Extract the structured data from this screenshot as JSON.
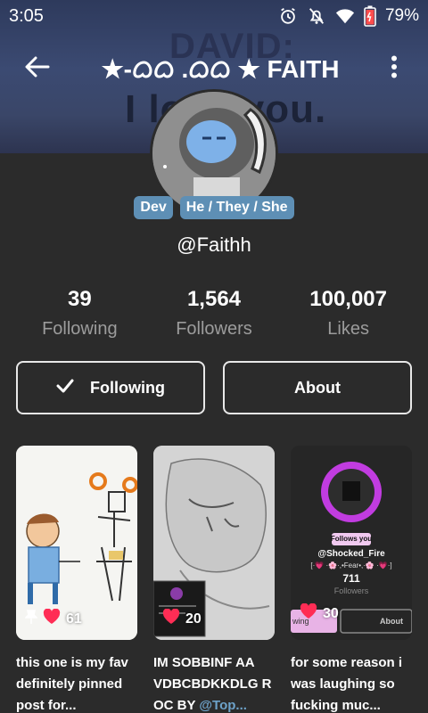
{
  "status_bar": {
    "time": "3:05",
    "battery": "79%",
    "icons": [
      "alarm-icon",
      "notifications-off-icon",
      "wifi-icon",
      "battery-icon"
    ]
  },
  "banner": {
    "line1": "DAVID:",
    "line2": "I love you."
  },
  "header": {
    "title": "★-ᜊᜊ .ᜊᜊ ★ FAITH",
    "icons": [
      "back-arrow-icon",
      "more-vertical-icon"
    ]
  },
  "profile": {
    "badges": [
      "Dev",
      "He / They / She"
    ],
    "username": "@Faithh"
  },
  "stats": [
    {
      "value": "39",
      "label": "Following"
    },
    {
      "value": "1,564",
      "label": "Followers"
    },
    {
      "value": "100,007",
      "label": "Likes"
    }
  ],
  "actions": {
    "following_label": "Following",
    "about_label": "About"
  },
  "posts": [
    {
      "likes": "61",
      "caption": "this one is my fav definitely pinned post for...",
      "pinned": true
    },
    {
      "likes": "20",
      "caption_text": "IM SOBBINF AA VDBCBDKKDLG R OC BY ",
      "caption_mention": "@Top..."
    },
    {
      "likes": "30",
      "caption": "for some reason i was laughing so fucking muc..."
    }
  ],
  "post3_embed": {
    "follows_you": "Follows you",
    "handle": "@Shocked_Fire",
    "tagline": "[·💗 ·🌸·,•Fear•,·🌸 ·💗·]",
    "count": "711",
    "count_label": "Followers",
    "btn_left": "wing",
    "btn_right": "About"
  },
  "colors": {
    "background": "#2b2b2b",
    "badge": "#5e8fb5",
    "heart": "#ff2d55",
    "mention": "#6da2c9"
  }
}
